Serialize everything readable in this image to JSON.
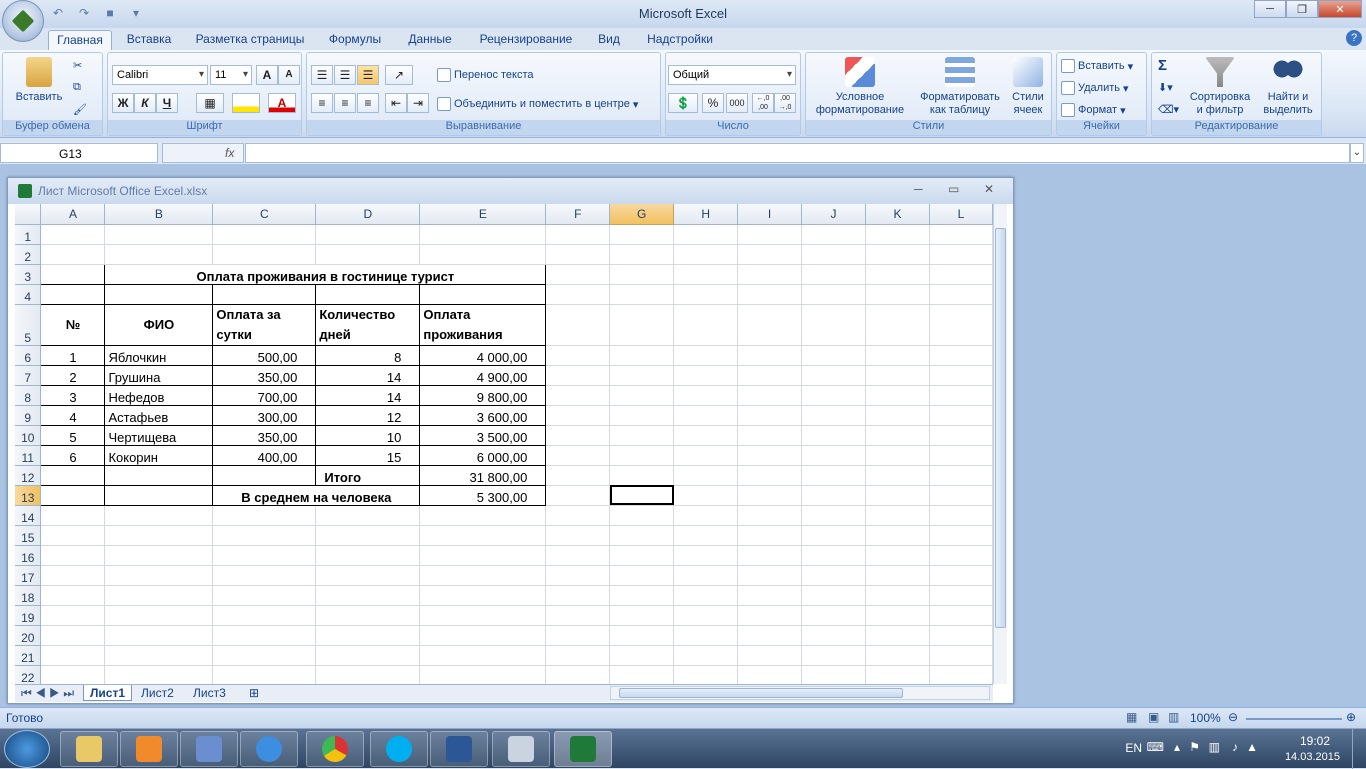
{
  "app": {
    "title": "Microsoft Excel"
  },
  "tabs": [
    "Главная",
    "Вставка",
    "Разметка страницы",
    "Формулы",
    "Данные",
    "Рецензирование",
    "Вид",
    "Надстройки"
  ],
  "help": "?",
  "ribbon": {
    "clipboard": {
      "label": "Буфер обмена",
      "paste": "Вставить"
    },
    "font": {
      "label": "Шрифт",
      "name": "Calibri",
      "size": "11",
      "grow": "A",
      "shrink": "A",
      "bold": "Ж",
      "italic": "К",
      "underline": "Ч",
      "color_letter": "A"
    },
    "alignment": {
      "label": "Выравнивание",
      "wrap": "Перенос текста",
      "merge": "Объединить и поместить в центре"
    },
    "number": {
      "label": "Число",
      "format": "Общий",
      "percent": "%",
      "thousands": "000",
      "inc": "←,0 ,00",
      "dec": ",00 →,0"
    },
    "styles": {
      "label": "Стили",
      "cond": "Условное форматирование",
      "table": "Форматировать как таблицу",
      "cell": "Стили ячеек"
    },
    "cells": {
      "label": "Ячейки",
      "insert": "Вставить",
      "delete": "Удалить",
      "format": "Формат"
    },
    "editing": {
      "label": "Редактирование",
      "sum": "Σ",
      "sort": "Сортировка и фильтр",
      "find": "Найти и выделить"
    }
  },
  "formula_bar": {
    "name_box": "G13",
    "fx": "fx",
    "value": ""
  },
  "workbook": {
    "title": "Лист Microsoft Office Excel.xlsx"
  },
  "columns": [
    "A",
    "B",
    "C",
    "D",
    "E",
    "F",
    "G",
    "H",
    "I",
    "J",
    "K",
    "L"
  ],
  "rows": [
    "1",
    "2",
    "3",
    "4",
    "5",
    "6",
    "7",
    "8",
    "9",
    "10",
    "11",
    "12",
    "13",
    "14",
    "15",
    "16",
    "17",
    "18",
    "19",
    "20",
    "21",
    "22"
  ],
  "table": {
    "title": "Оплата проживания в гостинице турист",
    "headers": {
      "num": "№",
      "fio": "ФИО",
      "rate1": "Оплата за",
      "rate2": "сутки",
      "days1": "Количество",
      "days2": "дней",
      "pay1": "Оплата",
      "pay2": "проживания"
    },
    "data": [
      {
        "n": "1",
        "name": "Яблочкин",
        "rate": "500,00",
        "days": "8",
        "pay": "4 000,00"
      },
      {
        "n": "2",
        "name": "Грушина",
        "rate": "350,00",
        "days": "14",
        "pay": "4 900,00"
      },
      {
        "n": "3",
        "name": "Нефедов",
        "rate": "700,00",
        "days": "14",
        "pay": "9 800,00"
      },
      {
        "n": "4",
        "name": "Астафьев",
        "rate": "300,00",
        "days": "12",
        "pay": "3 600,00"
      },
      {
        "n": "5",
        "name": "Чертищева",
        "rate": "350,00",
        "days": "10",
        "pay": "3 500,00"
      },
      {
        "n": "6",
        "name": "Кокорин",
        "rate": "400,00",
        "days": "15",
        "pay": "6 000,00"
      }
    ],
    "total_label": "Итого",
    "total_value": "31 800,00",
    "avg_label": "В среднем на человека",
    "avg_value": "5 300,00"
  },
  "sheets": [
    "Лист1",
    "Лист2",
    "Лист3"
  ],
  "status": {
    "ready": "Готово",
    "zoom": "100%"
  },
  "tray": {
    "lang": "EN",
    "time": "19:02",
    "date": "14.03.2015"
  }
}
